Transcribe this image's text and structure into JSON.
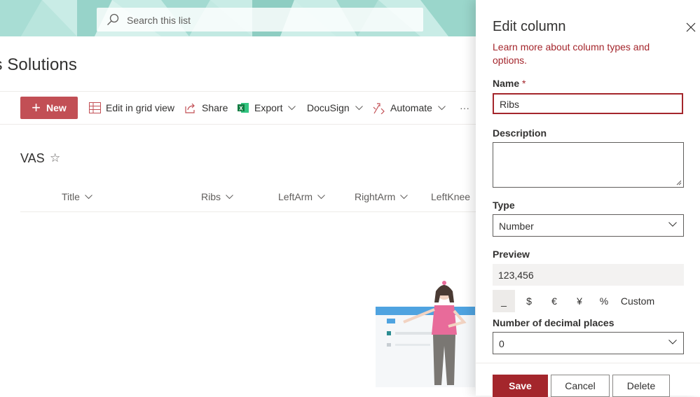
{
  "header": {
    "search_placeholder": "Search this list",
    "site_title": "ps Solutions"
  },
  "commands": {
    "new_label": "New",
    "edit_grid_label": "Edit in grid view",
    "share_label": "Share",
    "export_label": "Export",
    "docusign_label": "DocuSign",
    "automate_label": "Automate",
    "more_label": "···"
  },
  "list": {
    "title": "VAS",
    "columns": [
      "Title",
      "Ribs",
      "LeftArm",
      "RightArm",
      "LeftKnee"
    ]
  },
  "panel": {
    "title": "Edit column",
    "learn_more": "Learn more about column types and options.",
    "name_label": "Name",
    "required_marker": "*",
    "name_value": "Ribs",
    "description_label": "Description",
    "type_label": "Type",
    "type_value": "Number",
    "preview_label": "Preview",
    "preview_value": "123,456",
    "formats": [
      "_",
      "$",
      "€",
      "¥",
      "%",
      "Custom"
    ],
    "decimal_label": "Number of decimal places",
    "decimal_value": "0",
    "save_label": "Save",
    "cancel_label": "Cancel",
    "delete_label": "Delete"
  },
  "colors": {
    "accent": "#a4262c",
    "new_button": "#c24f55",
    "banner": "#c9ece6"
  },
  "icons": [
    "search-icon",
    "grid-icon",
    "share-icon",
    "excel-icon",
    "automate-icon",
    "star-icon",
    "chevron-down-icon",
    "close-icon"
  ]
}
